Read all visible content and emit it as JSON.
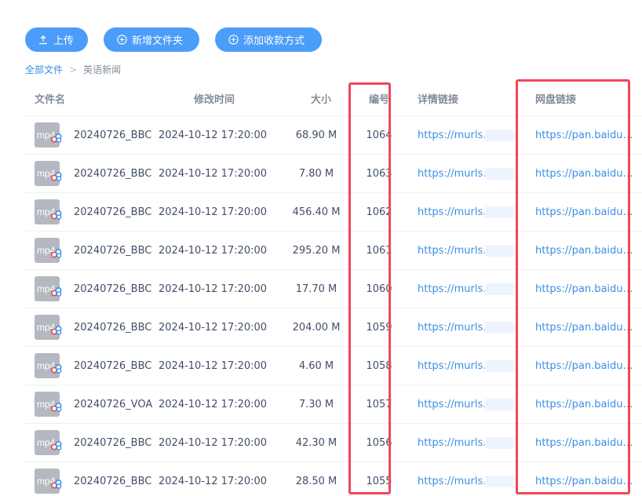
{
  "toolbar": {
    "upload_label": "上传",
    "new_folder_label": "新增文件夹",
    "add_payment_label": "添加收款方式"
  },
  "breadcrumb": {
    "root": "全部文件",
    "separator": ">",
    "current": "英语新闻"
  },
  "table": {
    "headers": {
      "name": "文件名",
      "modified": "修改时间",
      "size": "大小",
      "number": "编号",
      "detail_link": "详情链接",
      "pan_link": "网盘链接"
    },
    "rows": [
      {
        "icon_text": "mp4",
        "name": "20240726_BBC",
        "modified": "2024-10-12 17:20:00",
        "size": "68.90 M",
        "number": "1064",
        "detail_link": "https://murls.cn",
        "pan_link": "https://pan.baidu.com"
      },
      {
        "icon_text": "mp4",
        "name": "20240726_BBC",
        "modified": "2024-10-12 17:20:00",
        "size": "7.80 M",
        "number": "1063",
        "detail_link": "https://murls.cn/",
        "pan_link": "https://pan.baidu.com"
      },
      {
        "icon_text": "mp4",
        "name": "20240726_BBC",
        "modified": "2024-10-12 17:20:00",
        "size": "456.40 M",
        "number": "1062",
        "detail_link": "https://murls.cn/",
        "pan_link": "https://pan.baidu.com"
      },
      {
        "icon_text": "mp4",
        "name": "20240726_BBC",
        "modified": "2024-10-12 17:20:00",
        "size": "295.20 M",
        "number": "1061",
        "detail_link": "https://murls.cn",
        "pan_link": "https://pan.baidu.com"
      },
      {
        "icon_text": "mp4",
        "name": "20240726_BBC",
        "modified": "2024-10-12 17:20:00",
        "size": "17.70 M",
        "number": "1060",
        "detail_link": "https://murls.cn/",
        "pan_link": "https://pan.baidu.com"
      },
      {
        "icon_text": "mp4",
        "name": "20240726_BBC",
        "modified": "2024-10-12 17:20:00",
        "size": "204.00 M",
        "number": "1059",
        "detail_link": "https://murls.cn",
        "pan_link": "https://pan.baidu.com"
      },
      {
        "icon_text": "mp4",
        "name": "20240726_BBC",
        "modified": "2024-10-12 17:20:00",
        "size": "4.60 M",
        "number": "1058",
        "detail_link": "https://murls.cn",
        "pan_link": "https://pan.baidu.com"
      },
      {
        "icon_text": "mp4",
        "name": "20240726_VOA",
        "modified": "2024-10-12 17:20:00",
        "size": "7.30 M",
        "number": "1057",
        "detail_link": "https://murls.cn",
        "pan_link": "https://pan.baidu.com"
      },
      {
        "icon_text": "mp4",
        "name": "20240726_BBC",
        "modified": "2024-10-12 17:20:00",
        "size": "42.30 M",
        "number": "1056",
        "detail_link": "https://murls.cn/",
        "pan_link": "https://pan.baidu.com"
      },
      {
        "icon_text": "mp4",
        "name": "20240726_BBC",
        "modified": "2024-10-12 17:20:00",
        "size": "28.50 M",
        "number": "1055",
        "detail_link": "https://murls.cn/",
        "pan_link": "https://pan.baidu.com"
      }
    ]
  },
  "colors": {
    "primary": "#4a9df8",
    "link": "#3a8ee6",
    "highlight": "#f0475b",
    "text": "#424e67",
    "header_text": "#828c99"
  },
  "icons": {
    "upload": "upload-icon",
    "new_folder": "plus-circle-icon",
    "add_payment": "plus-circle-icon",
    "file": "mp4-file-icon",
    "file_badge": "baidu-pan-badge-icon"
  }
}
